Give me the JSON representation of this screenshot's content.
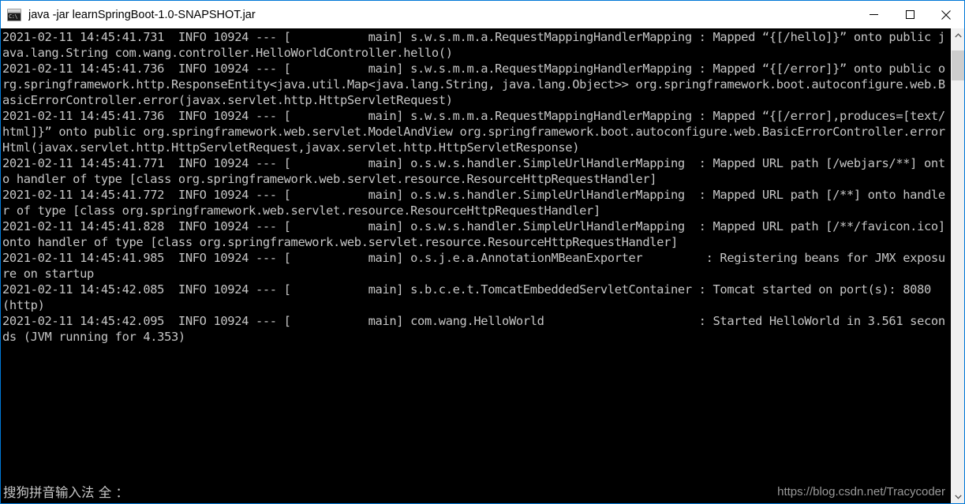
{
  "window": {
    "title": "java  -jar learnSpringBoot-1.0-SNAPSHOT.jar",
    "icon": "cmd-console-icon",
    "icon_text": "C:\\",
    "border_color": "#0078d7",
    "titlebar_background": "#ffffff",
    "console_background": "#000000",
    "console_foreground": "#c6c6c6"
  },
  "window_controls": {
    "minimize_label": "—",
    "maximize_label": "□",
    "close_label": "✕"
  },
  "scrollbar": {
    "up_arrow": "˄",
    "down_arrow": "˅",
    "thumb_position_percent": 2,
    "thumb_color": "#cdcdcd",
    "track_color": "#f0f0f0"
  },
  "console": {
    "lines": [
      "2021-02-11 14:45:41.731  INFO 10924 --- [           main] s.w.s.m.m.a.RequestMappingHandlerMapping : Mapped “{[/hello]}” onto public java.lang.String com.wang.controller.HelloWorldController.hello()",
      "2021-02-11 14:45:41.736  INFO 10924 --- [           main] s.w.s.m.m.a.RequestMappingHandlerMapping : Mapped “{[/error]}” onto public org.springframework.http.ResponseEntity<java.util.Map<java.lang.String, java.lang.Object>> org.springframework.boot.autoconfigure.web.BasicErrorController.error(javax.servlet.http.HttpServletRequest)",
      "2021-02-11 14:45:41.736  INFO 10924 --- [           main] s.w.s.m.m.a.RequestMappingHandlerMapping : Mapped “{[/error],produces=[text/html]}” onto public org.springframework.web.servlet.ModelAndView org.springframework.boot.autoconfigure.web.BasicErrorController.errorHtml(javax.servlet.http.HttpServletRequest,javax.servlet.http.HttpServletResponse)",
      "2021-02-11 14:45:41.771  INFO 10924 --- [           main] o.s.w.s.handler.SimpleUrlHandlerMapping  : Mapped URL path [/webjars/**] onto handler of type [class org.springframework.web.servlet.resource.ResourceHttpRequestHandler]",
      "2021-02-11 14:45:41.772  INFO 10924 --- [           main] o.s.w.s.handler.SimpleUrlHandlerMapping  : Mapped URL path [/**] onto handler of type [class org.springframework.web.servlet.resource.ResourceHttpRequestHandler]",
      "2021-02-11 14:45:41.828  INFO 10924 --- [           main] o.s.w.s.handler.SimpleUrlHandlerMapping  : Mapped URL path [/**/favicon.ico] onto handler of type [class org.springframework.web.servlet.resource.ResourceHttpRequestHandler]",
      "2021-02-11 14:45:41.985  INFO 10924 --- [           main] o.s.j.e.a.AnnotationMBeanExporter         : Registering beans for JMX exposure on startup",
      "2021-02-11 14:45:42.085  INFO 10924 --- [           main] s.b.c.e.t.TomcatEmbeddedServletContainer : Tomcat started on port(s): 8080 (http)",
      "2021-02-11 14:45:42.095  INFO 10924 --- [           main] com.wang.HelloWorld                      : Started HelloWorld in 3.561 seconds (JVM running for 4.353)"
    ]
  },
  "overlays": {
    "ime_status": "搜狗拼音输入法 全 ：",
    "watermark": "https://blog.csdn.net/Tracycoder"
  }
}
